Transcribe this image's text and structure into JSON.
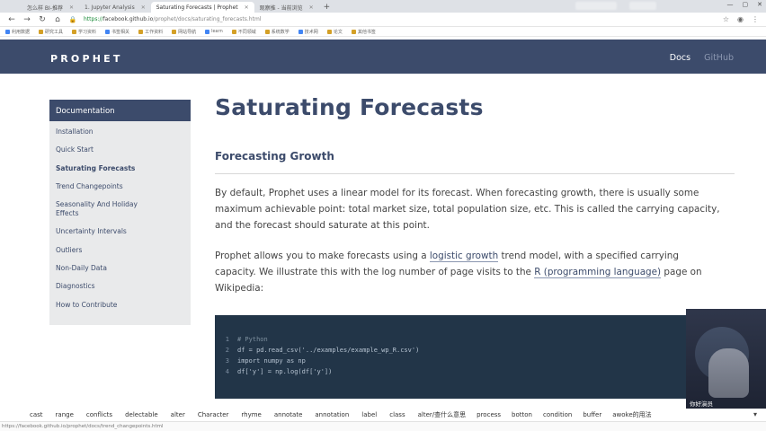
{
  "browser": {
    "tabs": [
      {
        "label": "怎么样 BI-推荐",
        "active": false
      },
      {
        "label": "1. Jupyter Analysis",
        "active": false
      },
      {
        "label": "Saturating Forecasts | Prophet",
        "active": true
      },
      {
        "label": "观察推 - 当前浏览",
        "active": false
      }
    ],
    "url": {
      "scheme": "https://",
      "host": "facebook.github.io",
      "path": "/prophet/docs/saturating_forecasts.html"
    },
    "bookmarks": [
      "利用数据",
      "研究工具",
      "学习资料",
      "书签相关",
      "工作资料",
      "网站导航",
      "learn",
      "不同领域",
      "系统数学",
      "技术网",
      "论文",
      "其他书签"
    ]
  },
  "site": {
    "logo": "PROPHET",
    "nav": [
      {
        "label": "Docs",
        "dim": false
      },
      {
        "label": "GitHub",
        "dim": true
      }
    ]
  },
  "sidebar": {
    "title": "Documentation",
    "items": [
      {
        "label": "Installation",
        "active": false
      },
      {
        "label": "Quick Start",
        "active": false
      },
      {
        "label": "Saturating Forecasts",
        "active": true
      },
      {
        "label": "Trend Changepoints",
        "active": false
      },
      {
        "label": "Seasonality And Holiday",
        "active": false,
        "cont": "Effects"
      },
      {
        "label": "Uncertainty Intervals",
        "active": false
      },
      {
        "label": "Outliers",
        "active": false
      },
      {
        "label": "Non-Daily Data",
        "active": false
      },
      {
        "label": "Diagnostics",
        "active": false
      },
      {
        "label": "How to Contribute",
        "active": false
      }
    ]
  },
  "content": {
    "title": "Saturating Forecasts",
    "subtitle": "Forecasting Growth",
    "p1": {
      "l1": "By default, Prophet uses a linear model for its forecast. When forecasting growth, there is usually some",
      "l2": "maximum achievable point: total market size, total population size, etc. This is called the carrying capacity,",
      "l3": "and the forecast should saturate at this point."
    },
    "p2": {
      "l1a": "Prophet allows you to make forecasts using a ",
      "l1link": "logistic growth",
      "l1b": " trend model, with a specified carrying",
      "l2a": "capacity. We illustrate this with the log number of page visits to the ",
      "l2link": "R (programming language)",
      "l2b": " page on",
      "l3": "Wikipedia:"
    },
    "code": [
      {
        "n": "1",
        "text": "# Python",
        "comment": true
      },
      {
        "n": "2",
        "text": "df = pd.read_csv('../examples/example_wp_R.csv')",
        "comment": false
      },
      {
        "n": "3",
        "text": "import numpy as np",
        "comment": false
      },
      {
        "n": "4",
        "text": "df['y'] = np.log(df['y'])",
        "comment": false
      }
    ]
  },
  "video": {
    "caption": "你好演员"
  },
  "tagstrip": [
    "cast",
    "range",
    "conflicts",
    "delectable",
    "alter",
    "Character",
    "rhyme",
    "annotate",
    "annotation",
    "label",
    "class",
    "alter/查什么意思",
    "process",
    "botton",
    "condition",
    "buffer",
    "awoke的用法"
  ],
  "statusbar": "https://facebook.github.io/prophet/docs/trend_changepoints.html"
}
